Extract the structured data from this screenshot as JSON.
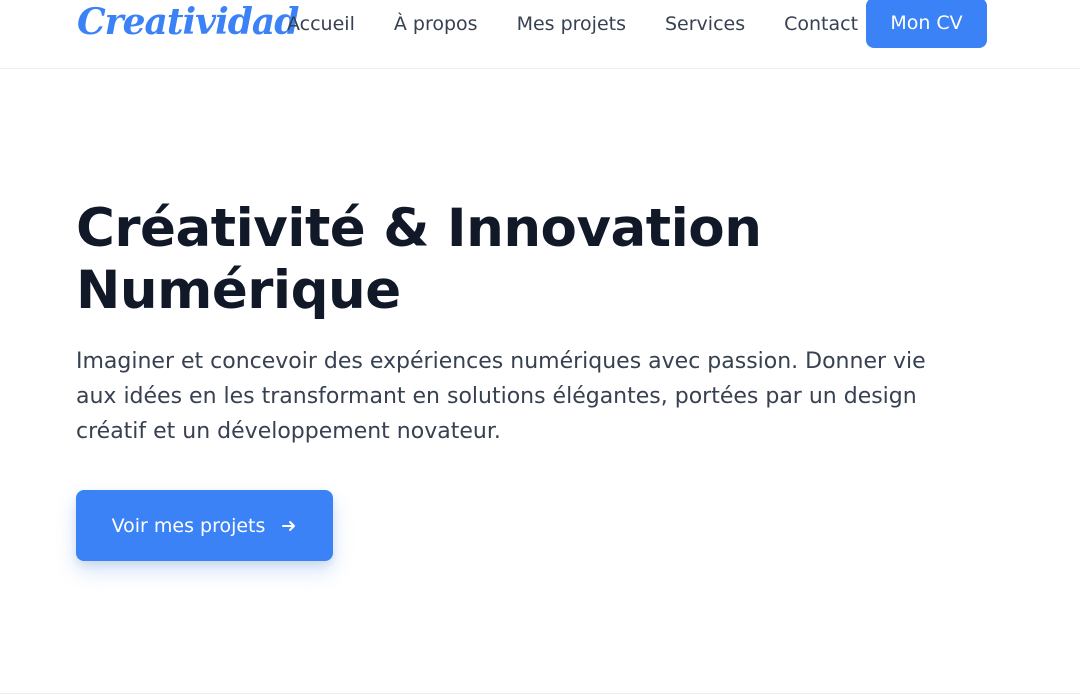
{
  "header": {
    "logo_text": "Creatividad",
    "nav": [
      {
        "label": "Accueil"
      },
      {
        "label": "À propos"
      },
      {
        "label": "Mes projets"
      },
      {
        "label": "Services"
      },
      {
        "label": "Contact"
      }
    ],
    "cv_button_label": "Mon CV"
  },
  "hero": {
    "title_line1": "Créativité & Innovation",
    "title_line2": "Numérique",
    "description": "Imaginer et concevoir des expériences numériques avec passion. Donner vie aux idées en les transformant en solutions élégantes, portées par un design créatif et un développement novateur.",
    "cta_label": "Voir mes projets",
    "cta_icon": "arrow-right-icon"
  },
  "colors": {
    "accent": "#3b82f6",
    "heading": "#111827",
    "body_text": "#374151"
  }
}
